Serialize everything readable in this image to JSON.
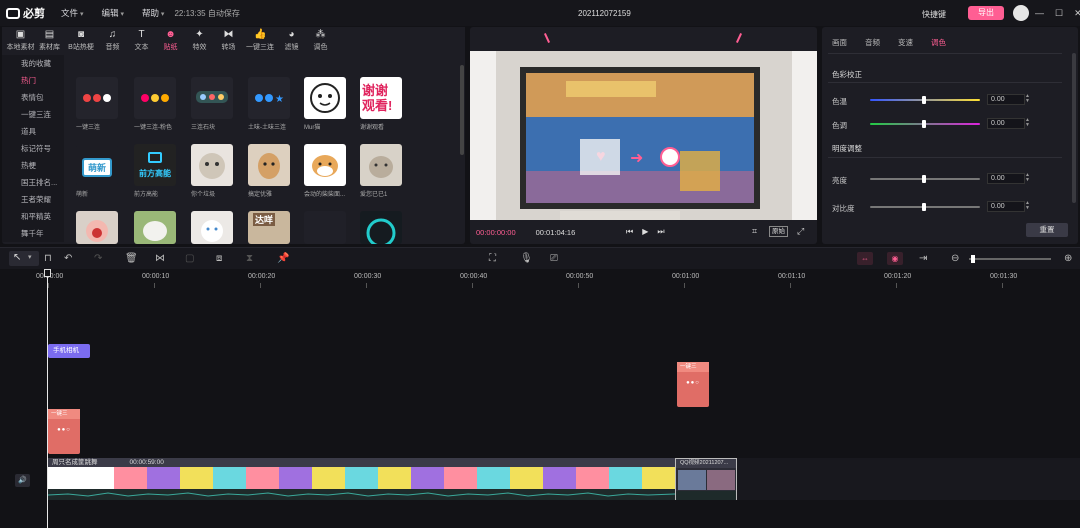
{
  "app": {
    "name": "必剪",
    "project": "202112072159",
    "autosave": "22:13:35 自动保存",
    "shortcut": "快捷键",
    "export": "导出"
  },
  "menu": [
    "文件",
    "编辑",
    "帮助"
  ],
  "media_tabs": [
    {
      "label": "本地素材",
      "icon": "folder-icon"
    },
    {
      "label": "素材库",
      "icon": "library-icon"
    },
    {
      "label": "B站热梗",
      "icon": "bilibili-icon"
    },
    {
      "label": "音频",
      "icon": "music-icon"
    },
    {
      "label": "文本",
      "icon": "text-icon"
    },
    {
      "label": "贴纸",
      "icon": "sticker-icon"
    },
    {
      "label": "特效",
      "icon": "effect-icon"
    },
    {
      "label": "转场",
      "icon": "transition-icon"
    },
    {
      "label": "一键三连",
      "icon": "like-icon"
    },
    {
      "label": "滤镜",
      "icon": "filter-icon"
    },
    {
      "label": "调色",
      "icon": "color-icon"
    }
  ],
  "sticker_categories": [
    "我的收藏",
    "热门",
    "表情包",
    "一键三连",
    "道具",
    "标记符号",
    "热梗",
    "国王排名...",
    "王者荣耀",
    "和平精英",
    "舞千年"
  ],
  "stickers": [
    "一键三连",
    "一键三连-粉色",
    "三连石块",
    "土味-土味三连",
    "Mur猫",
    "谢谢观看",
    "萌新",
    "前方高能",
    "你个垃圾",
    "搞定优雅",
    "会动的柴柴面...",
    "爱您已已1"
  ],
  "sticker_text": {
    "thanks": "谢谢观看!",
    "newbie": "萌新",
    "warning": "前方高能",
    "hd": "达咩"
  },
  "preview": {
    "current": "00:00:00:00",
    "total": "00:01:04:16",
    "ratio": "原始"
  },
  "props": {
    "tabs": [
      "画面",
      "音频",
      "变速",
      "调色"
    ],
    "section1": "色彩校正",
    "section2": "明度调整",
    "rows": [
      {
        "label": "色温",
        "value": "0.00",
        "level": 0.5
      },
      {
        "label": "色调",
        "value": "0.00",
        "level": 0.5
      },
      {
        "label": "亮度",
        "value": "0.00",
        "level": 0.5
      },
      {
        "label": "对比度",
        "value": "0.00",
        "level": 0.5
      }
    ],
    "reset": "重置"
  },
  "ruler": [
    "00:00:00",
    "00:00:10",
    "00:00:20",
    "00:00:30",
    "00:00:40",
    "00:00:50",
    "00:01:00",
    "00:01:10",
    "00:01:20",
    "00:01:30"
  ],
  "tracks": {
    "fx_clip": "手机相机",
    "sticker1": "一键三",
    "sticker2": "一键三",
    "main_clip": "周只名成筐跳舞",
    "main_clip_time": "00:00:59:00",
    "clip2": "QQ视频20211207..."
  },
  "colors": {
    "accent": "#ff5e93",
    "fx": "#7b6cf0",
    "sticker": "#e06d66"
  }
}
